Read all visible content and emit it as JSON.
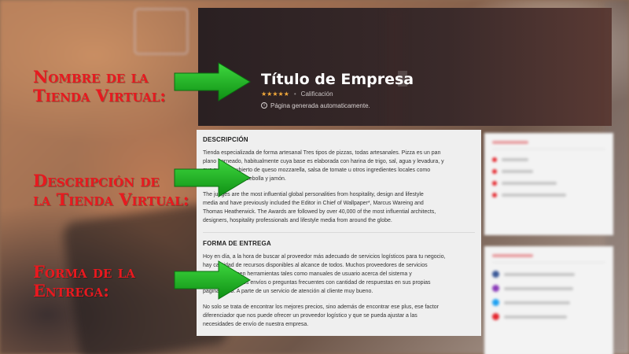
{
  "hero": {
    "title": "Título de Empresa",
    "stars": "★★★★★",
    "rating_label": "Calificación",
    "auto_text": "Página generada automaticamente."
  },
  "description": {
    "heading": "DESCRIPCIÓN",
    "paragraphs": [
      "Tienda especializada de forma artesanal Tres tipos de pizzas, todas artesanales. Pizza es un pan\nplano horneado, habitualmente cuya base es elaborada con harina de trigo, sal, agua y levadura, y\nque suele ir cubierto de queso mozzarella, salsa de tomate u otros ingredientes locales como\nsardinas, tiras de cebolla y jamón.",
      "The judges are the most influential global personalities from hospitality, design and lifestyle\nmedia and have previously included the Editor in Chief of Wallpaper*, Marcus Wareing and\nThomas Heatherwick. The Awards are followed by over 40,000 of the most influential architects,\ndesigners, hospitality professionals and lifestyle media from around the globe."
    ]
  },
  "delivery": {
    "heading": "FORMA DE ENTREGA",
    "paragraphs": [
      "Hoy en día, a la hora de buscar al proveedor más adecuado de servicios logísticos para tu negocio,\nhay cantidad de recursos disponibles al alcance de todos. Muchos proveedores de servicios\nlogísticos ofrecen herramientas tales como manuales de usuario acerca del sistema y\nseguimiento de los envíos o preguntas frecuentes con cantidad de respuestas en sus propias\npáginas web. A parte de un servicio de atención al cliente muy bueno.",
      "No solo se trata de encontrar los mejores precios, sino además de encontrar ese plus, ese factor\ndiferenciador que nos puede ofrecer un proveedor logístico y que se pueda ajustar a las\nnecesidades de envío de nuestra empresa."
    ]
  },
  "annotations": {
    "store_name": [
      "Nombre de la",
      "Tienda Virtual:"
    ],
    "store_description": [
      "Descripción de",
      "la Tienda Virtual:"
    ],
    "delivery_method": [
      "Forma de la",
      "Entrega:"
    ]
  },
  "colors": {
    "annotation_red": "#e8191f",
    "arrow_green": "#1db222",
    "star_orange": "#f2a93b",
    "sidebar_accent": "#e5262d"
  }
}
